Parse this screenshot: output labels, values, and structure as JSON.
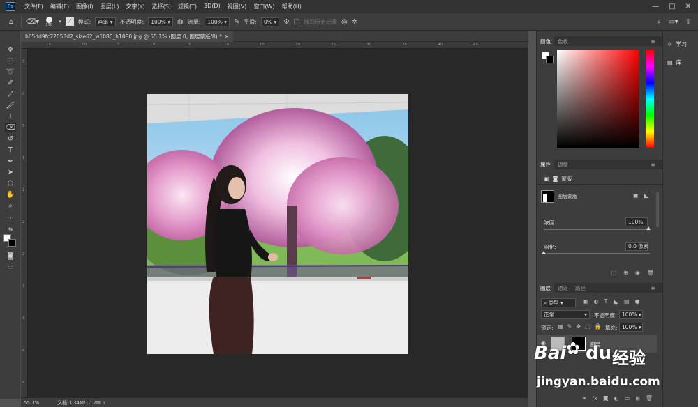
{
  "app": {
    "logo_text": "Ps"
  },
  "menu": [
    "文件(F)",
    "编辑(E)",
    "图像(I)",
    "图层(L)",
    "文字(Y)",
    "选择(S)",
    "滤镜(T)",
    "3D(D)",
    "视图(V)",
    "窗口(W)",
    "帮助(H)"
  ],
  "window_controls": {
    "minimize": "—",
    "restore": "□",
    "close": "✕"
  },
  "options": {
    "brush_size": "150",
    "mode_label": "模式:",
    "mode_value": "画笔",
    "opacity_label": "不透明度:",
    "opacity_value": "100%",
    "flow_label": "流量:",
    "flow_value": "100%",
    "smoothing_label": "平滑:",
    "smoothing_value": "0%",
    "erase_history_label": "抹到历史记录"
  },
  "document": {
    "tab_title": "b65dd9fc72053d2_size62_w1080_h1080.jpg @ 55.1% (图层 0, 图层蒙版/8) *",
    "tab_close": "✕"
  },
  "ruler": {
    "h_ticks": [
      "15",
      "10",
      "5",
      "0",
      "5",
      "10",
      "15",
      "20",
      "25",
      "30",
      "35",
      "40",
      "45"
    ],
    "v_ticks": [
      "5",
      "0",
      "5",
      "1",
      "1",
      "2",
      "2",
      "3",
      "3",
      "4",
      "4"
    ]
  },
  "status": {
    "zoom": "55.1%",
    "doc_info": "文档:3.34M/10.2M"
  },
  "color_panel": {
    "tabs": [
      "颜色",
      "色板"
    ],
    "fg": "#ffffff",
    "bg": "#000000",
    "hue_color": "#ff0000"
  },
  "properties_panel": {
    "tabs": [
      "属性",
      "调整"
    ],
    "mask_label": "蒙版",
    "layer_mask_label": "图层蒙版",
    "density_label": "浓度:",
    "density_value": "100%",
    "feather_label": "羽化:",
    "feather_value": "0.0 像素"
  },
  "layers_panel": {
    "tabs": [
      "图层",
      "通道",
      "路径"
    ],
    "filter_kind": "类型",
    "blend_mode": "正常",
    "opacity_label": "不透明度:",
    "opacity_value": "100%",
    "lock_label": "锁定:",
    "fill_label": "填充:",
    "fill_value": "100%",
    "layer_name": "图层"
  },
  "learn_panel": {
    "learn_label": "学习",
    "library_label": "库"
  },
  "watermark": {
    "line1": "Bai",
    "line2": "du",
    "line3": "经验",
    "url": "jingyan.baidu.com"
  }
}
